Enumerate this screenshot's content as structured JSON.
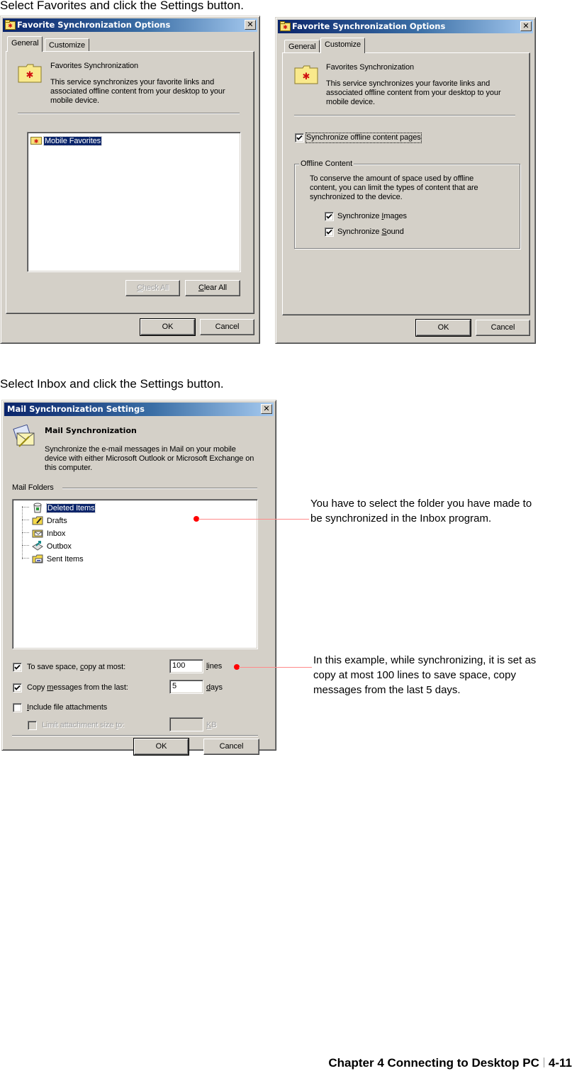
{
  "captions": {
    "favorites": "Select Favorites and click the Settings button.",
    "inbox": "Select Inbox and click the Settings button."
  },
  "favorites_general_dialog": {
    "title": "Favorite Synchronization Options",
    "tabs": [
      {
        "label": "General",
        "active": true
      },
      {
        "label": "Customize",
        "active": false
      }
    ],
    "heading": "Favorites Synchronization",
    "description": "This service synchronizes your favorite links and associated offline content from your desktop to your mobile device.",
    "tree_items": [
      {
        "label": "Mobile Favorites",
        "selected": true
      }
    ],
    "check_all_label": "Check All",
    "check_all_accel": "C",
    "clear_all_label": "Clear All",
    "clear_all_accel": "C",
    "ok_label": "OK",
    "cancel_label": "Cancel"
  },
  "favorites_customize_dialog": {
    "title": "Favorite Synchronization Options",
    "tabs": [
      {
        "label": "General",
        "active": false
      },
      {
        "label": "Customize",
        "active": true
      }
    ],
    "heading": "Favorites Synchronization",
    "description": "This service synchronizes your favorite links and associated offline content from your desktop to your mobile device.",
    "sync_offline": {
      "label": "Synchronize offline content pages",
      "checked": true
    },
    "offline_group": {
      "label": "Offline Content",
      "description": "To conserve the amount of space used by offline content, you can limit the types of content that are synchronized to the device.",
      "sync_images": {
        "label": "Synchronize Images",
        "checked": true
      },
      "sync_sound": {
        "label": "Synchronize Sound",
        "checked": true
      }
    },
    "ok_label": "OK",
    "cancel_label": "Cancel"
  },
  "mail_dialog": {
    "title": "Mail Synchronization Settings",
    "heading": "Mail Synchronization",
    "description": "Synchronize the e-mail messages in Mail on your mobile device with either Microsoft Outlook or Microsoft Exchange on this computer.",
    "folders_label": "Mail Folders",
    "folders": [
      {
        "label": "Deleted Items",
        "icon": "deleted-items-icon",
        "selected": true
      },
      {
        "label": "Drafts",
        "icon": "drafts-icon",
        "selected": false
      },
      {
        "label": "Inbox",
        "icon": "inbox-icon",
        "selected": false
      },
      {
        "label": "Outbox",
        "icon": "outbox-icon",
        "selected": false
      },
      {
        "label": "Sent Items",
        "icon": "sent-items-icon",
        "selected": false
      }
    ],
    "copy_at_most": {
      "label": "To save space, copy at most:",
      "checked": true,
      "value": "100",
      "unit": "lines"
    },
    "copy_last": {
      "label": "Copy messages from the last:",
      "checked": true,
      "value": "5",
      "unit": "days"
    },
    "include_attachments": {
      "label": "Include file attachments",
      "checked": false
    },
    "limit_size": {
      "label": "Limit attachment size to:",
      "checked": false,
      "value": "",
      "unit": "KB",
      "disabled": true
    },
    "ok_label": "OK",
    "cancel_label": "Cancel"
  },
  "annotations": {
    "folder_note": "You have to select the folder you have made to be synchronized in the Inbox program.",
    "example_note": "In this example, while synchronizing, it is set as copy at most 100 lines to save space, copy messages from the last 5 days.",
    "accent_color": "#ff0000"
  },
  "footer": {
    "chapter": "Chapter 4 Connecting to Desktop PC",
    "page": "4-11"
  }
}
